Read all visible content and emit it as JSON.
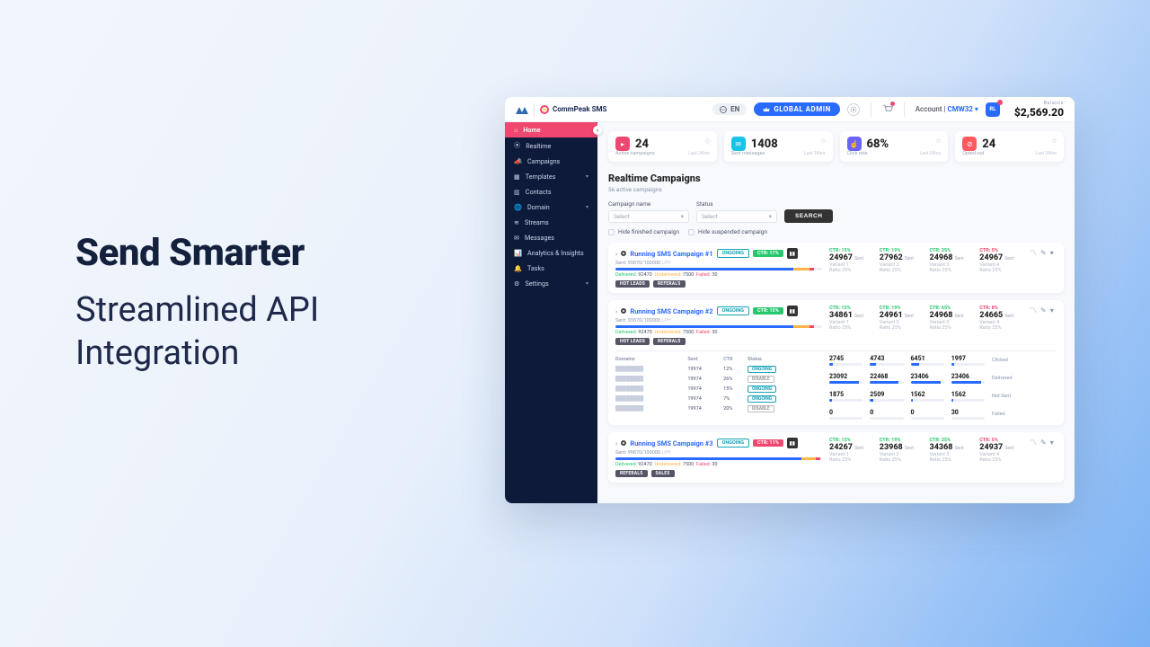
{
  "hero": {
    "title": "Send Smarter",
    "subtitle_line1": "Streamlined API",
    "subtitle_line2": "Integration"
  },
  "header": {
    "brand": "CommPeak SMS",
    "lang": "EN",
    "admin": "GLOBAL ADMIN",
    "account_label": "Account",
    "account_code": "CMW32",
    "avatar": "RL",
    "balance_label": "Balance",
    "balance_value": "$2,569.20"
  },
  "sidebar": {
    "items": [
      {
        "label": "Home",
        "active": true
      },
      {
        "label": "Realtime",
        "chev": false
      },
      {
        "label": "Campaigns",
        "chev": false
      },
      {
        "label": "Templates",
        "chev": true
      },
      {
        "label": "Contacts",
        "chev": false
      },
      {
        "label": "Domain",
        "chev": true
      },
      {
        "label": "Streams",
        "chev": false
      },
      {
        "label": "Messages",
        "chev": false
      },
      {
        "label": "Analytics & Insights",
        "chev": false
      },
      {
        "label": "Tasks",
        "chev": false
      },
      {
        "label": "Settings",
        "chev": true
      }
    ]
  },
  "kpi": {
    "period": "Last 24hrs",
    "cards": [
      {
        "value": "24",
        "label": "Active campaigns",
        "color": "c-red"
      },
      {
        "value": "1408",
        "label": "Sent messages",
        "color": "c-cyan"
      },
      {
        "value": "68%",
        "label": "Click rate",
        "color": "c-purp"
      },
      {
        "value": "24",
        "label": "Opted-out",
        "color": "c-red2"
      }
    ]
  },
  "realtime": {
    "heading": "Realtime Campaigns",
    "sub": "56 active campaigns",
    "label_name": "Campaign name",
    "label_status": "Status",
    "select_placeholder": "Select",
    "search": "SEARCH",
    "chk_finished": "Hide finished campaign",
    "chk_suspended": "Hide suspended campaign"
  },
  "c1": {
    "name": "Running SMS Campaign #1",
    "status": "ONGOING",
    "ctr": "CTR: 17%",
    "sent": "Sent: 93870/100000",
    "lph": "LPH",
    "delivered_l": "Delivered:",
    "delivered": "92470",
    "undelivered_l": "Undelivered:",
    "undelivered": "7500",
    "failed_l": "Failed:",
    "failed": "30",
    "tags": [
      "HOT LEADS",
      "REFERALS"
    ],
    "variants": [
      {
        "ctr": "CTR: 15%",
        "cls": "ctr-g",
        "val": "24967",
        "name": "Variant 1",
        "ratio": "Ratio 25%"
      },
      {
        "ctr": "CTR: 19%",
        "cls": "ctr-g",
        "val": "27962",
        "name": "Variant 2",
        "ratio": "Ratio 25%"
      },
      {
        "ctr": "CTR: 25%",
        "cls": "ctr-g",
        "val": "24968",
        "name": "Variant 3",
        "ratio": "Ratio 25%"
      },
      {
        "ctr": "CTR: 5%",
        "cls": "ctr-r",
        "val": "24967",
        "name": "Variant 4",
        "ratio": "Ratio 25%"
      }
    ]
  },
  "c2": {
    "name": "Running SMS Campaign #2",
    "status": "ONGOING",
    "ctr": "CTR: 15%",
    "sent": "Sent: 93870/100000",
    "lph": "LPH",
    "delivered_l": "Delivered:",
    "delivered": "92470",
    "undelivered_l": "Undelivered:",
    "undelivered": "7500",
    "failed_l": "Failed:",
    "failed": "30",
    "tags": [
      "HOT LEADS",
      "REFERALS"
    ],
    "variants": [
      {
        "ctr": "CTR: 15%",
        "cls": "ctr-g",
        "val": "34861",
        "name": "Variant 1",
        "ratio": "Ratio 25%"
      },
      {
        "ctr": "CTR: 19%",
        "cls": "ctr-g",
        "val": "24961",
        "name": "Variant 2",
        "ratio": "Ratio 25%"
      },
      {
        "ctr": "CTR: 65%",
        "cls": "ctr-g",
        "val": "24968",
        "name": "Variant 3",
        "ratio": "Ratio 25%"
      },
      {
        "ctr": "CTR: 8%",
        "cls": "ctr-r",
        "val": "24665",
        "name": "Variant 4",
        "ratio": "Ratio 25%"
      }
    ],
    "dom_hdr": {
      "d": "Domains",
      "s": "Sent",
      "c": "CTR",
      "st": "Status"
    },
    "domains": [
      {
        "sent": "19974",
        "ctr": "12%",
        "status": "ONGOING",
        "cls": "on"
      },
      {
        "sent": "19974",
        "ctr": "26%",
        "status": "DISABLE",
        "cls": "off"
      },
      {
        "sent": "19974",
        "ctr": "15%",
        "status": "ONGOING",
        "cls": "on"
      },
      {
        "sent": "19974",
        "ctr": "7%",
        "status": "ONGOING",
        "cls": "on"
      },
      {
        "sent": "19974",
        "ctr": "20%",
        "status": "DISABLE",
        "cls": "off"
      }
    ],
    "metric_rows": [
      {
        "lbl": "Clicked",
        "vals": [
          "2745",
          "4743",
          "6451",
          "1997"
        ]
      },
      {
        "lbl": "Delivered",
        "vals": [
          "23092",
          "22468",
          "23406",
          "23406"
        ]
      },
      {
        "lbl": "Not Sent",
        "vals": [
          "1875",
          "2509",
          "1562",
          "1562"
        ]
      },
      {
        "lbl": "Failed",
        "vals": [
          "0",
          "0",
          "0",
          "30"
        ]
      }
    ]
  },
  "c3": {
    "name": "Running SMS Campaign #3",
    "status": "ONGOING",
    "ctr": "CTR: 11%",
    "sent": "Sent: 99870/100000",
    "lph": "LPH",
    "delivered_l": "Delivered:",
    "delivered": "92470",
    "undelivered_l": "Undelivered:",
    "undelivered": "7500",
    "failed_l": "Failed:",
    "failed": "30",
    "tags": [
      "REFERALS",
      "SALES"
    ],
    "variants": [
      {
        "ctr": "CTR: 15%",
        "cls": "ctr-g",
        "val": "24267",
        "name": "Variant 1",
        "ratio": "Ratio 25%"
      },
      {
        "ctr": "CTR: 19%",
        "cls": "ctr-g",
        "val": "23968",
        "name": "Variant 2",
        "ratio": "Ratio 25%"
      },
      {
        "ctr": "CTR: 25%",
        "cls": "ctr-g",
        "val": "34368",
        "name": "Variant 3",
        "ratio": "Ratio 25%"
      },
      {
        "ctr": "CTR: 5%",
        "cls": "ctr-r",
        "val": "24937",
        "name": "Variant 4",
        "ratio": "Ratio 25%"
      }
    ]
  }
}
